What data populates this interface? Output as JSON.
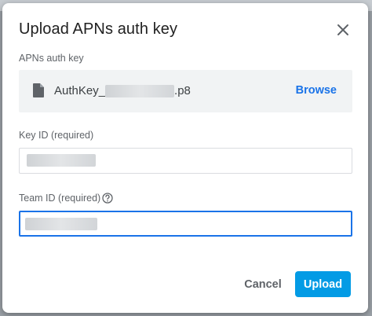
{
  "dialog": {
    "title": "Upload APNs auth key",
    "close_icon": "close-icon"
  },
  "auth_key": {
    "label": "APNs auth key",
    "file_icon": "file-icon",
    "file_name_prefix": "AuthKey_",
    "file_name_suffix": ".p8",
    "browse_label": "Browse"
  },
  "key_id": {
    "label": "Key ID (required)",
    "value": ""
  },
  "team_id": {
    "label": "Team ID (required)",
    "help_icon": "help-icon",
    "value": ""
  },
  "actions": {
    "cancel_label": "Cancel",
    "upload_label": "Upload"
  },
  "colors": {
    "accent": "#1a73e8",
    "primary_button": "#039be5"
  }
}
